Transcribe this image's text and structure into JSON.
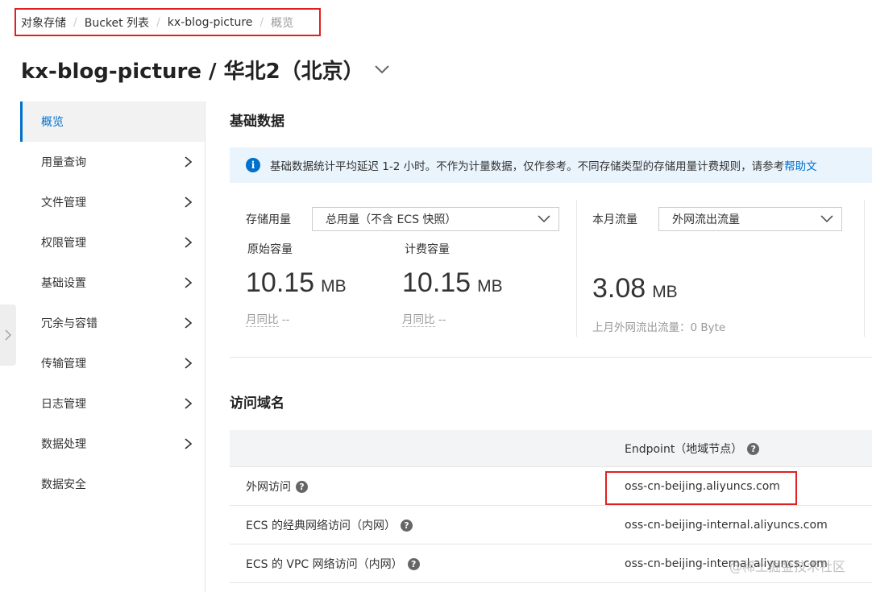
{
  "breadcrumb": {
    "items": [
      "对象存储",
      "Bucket 列表",
      "kx-blog-picture",
      "概览"
    ],
    "separator": "/"
  },
  "page": {
    "title": "kx-blog-picture / 华北2（北京）"
  },
  "sidebar": {
    "items": [
      {
        "label": "概览",
        "active": true,
        "has_chevron": false
      },
      {
        "label": "用量查询",
        "has_chevron": true
      },
      {
        "label": "文件管理",
        "has_chevron": true
      },
      {
        "label": "权限管理",
        "has_chevron": true
      },
      {
        "label": "基础设置",
        "has_chevron": true
      },
      {
        "label": "冗余与容错",
        "has_chevron": true
      },
      {
        "label": "传输管理",
        "has_chevron": true
      },
      {
        "label": "日志管理",
        "has_chevron": true
      },
      {
        "label": "数据处理",
        "has_chevron": true
      },
      {
        "label": "数据安全",
        "has_chevron": false
      }
    ]
  },
  "basic": {
    "title": "基础数据",
    "notice": "基础数据统计平均延迟 1-2 小时。不作为计量数据，仅作参考。不同存储类型的存储用量计费规则，请参考",
    "help_link": "帮助文"
  },
  "storage": {
    "label": "存储用量",
    "select_value": "总用量（不含 ECS 快照）",
    "raw": {
      "label": "原始容量",
      "value": "10.15",
      "unit": "MB",
      "compare": "月同比",
      "compare_value": "--"
    },
    "billed": {
      "label": "计费容量",
      "value": "10.15",
      "unit": "MB",
      "compare": "月同比",
      "compare_value": "--"
    }
  },
  "traffic": {
    "label": "本月流量",
    "select_value": "外网流出流量",
    "value": "3.08",
    "unit": "MB",
    "last_month": "上月外网流出流量：0 Byte"
  },
  "domain": {
    "title": "访问域名",
    "header_endpoint": "Endpoint（地域节点）",
    "rows": [
      {
        "name": "外网访问",
        "endpoint": "oss-cn-beijing.aliyuncs.com"
      },
      {
        "name": "ECS 的经典网络访问（内网）",
        "endpoint": "oss-cn-beijing-internal.aliyuncs.com"
      },
      {
        "name": "ECS 的 VPC 网络访问（内网）",
        "endpoint": "oss-cn-beijing-internal.aliyuncs.com"
      }
    ]
  },
  "watermark": "@稀土掘金技术社区",
  "colors": {
    "accent": "#0070cc",
    "highlight": "#e02020",
    "notice_bg": "#eaf4fd"
  }
}
